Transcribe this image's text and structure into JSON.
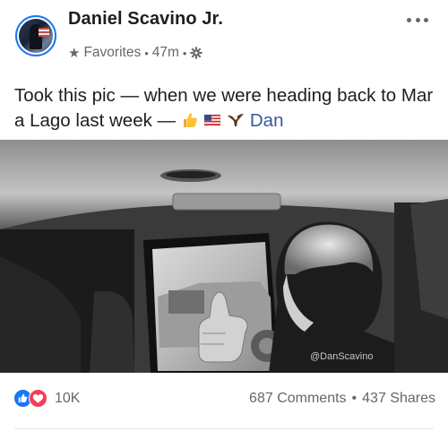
{
  "post": {
    "author": "Daniel Scavino Jr.",
    "audience": "Favorites",
    "time": "47m",
    "caption_text": "Took this pic — when we were heading back to Mar a Lago last week — ",
    "caption_tag": "Dan",
    "emoji_icons": [
      "thumbs-up-icon",
      "us-flag-icon",
      "eagle-icon"
    ],
    "watermark": "@DanScavino"
  },
  "footer": {
    "reaction_count": "10K",
    "comments": "687 Comments",
    "shares": "437 Shares",
    "separator": "•"
  },
  "colors": {
    "accent": "#1877f2",
    "love": "#f33e58",
    "secondary_text": "#65676b",
    "tag": "#385898"
  }
}
